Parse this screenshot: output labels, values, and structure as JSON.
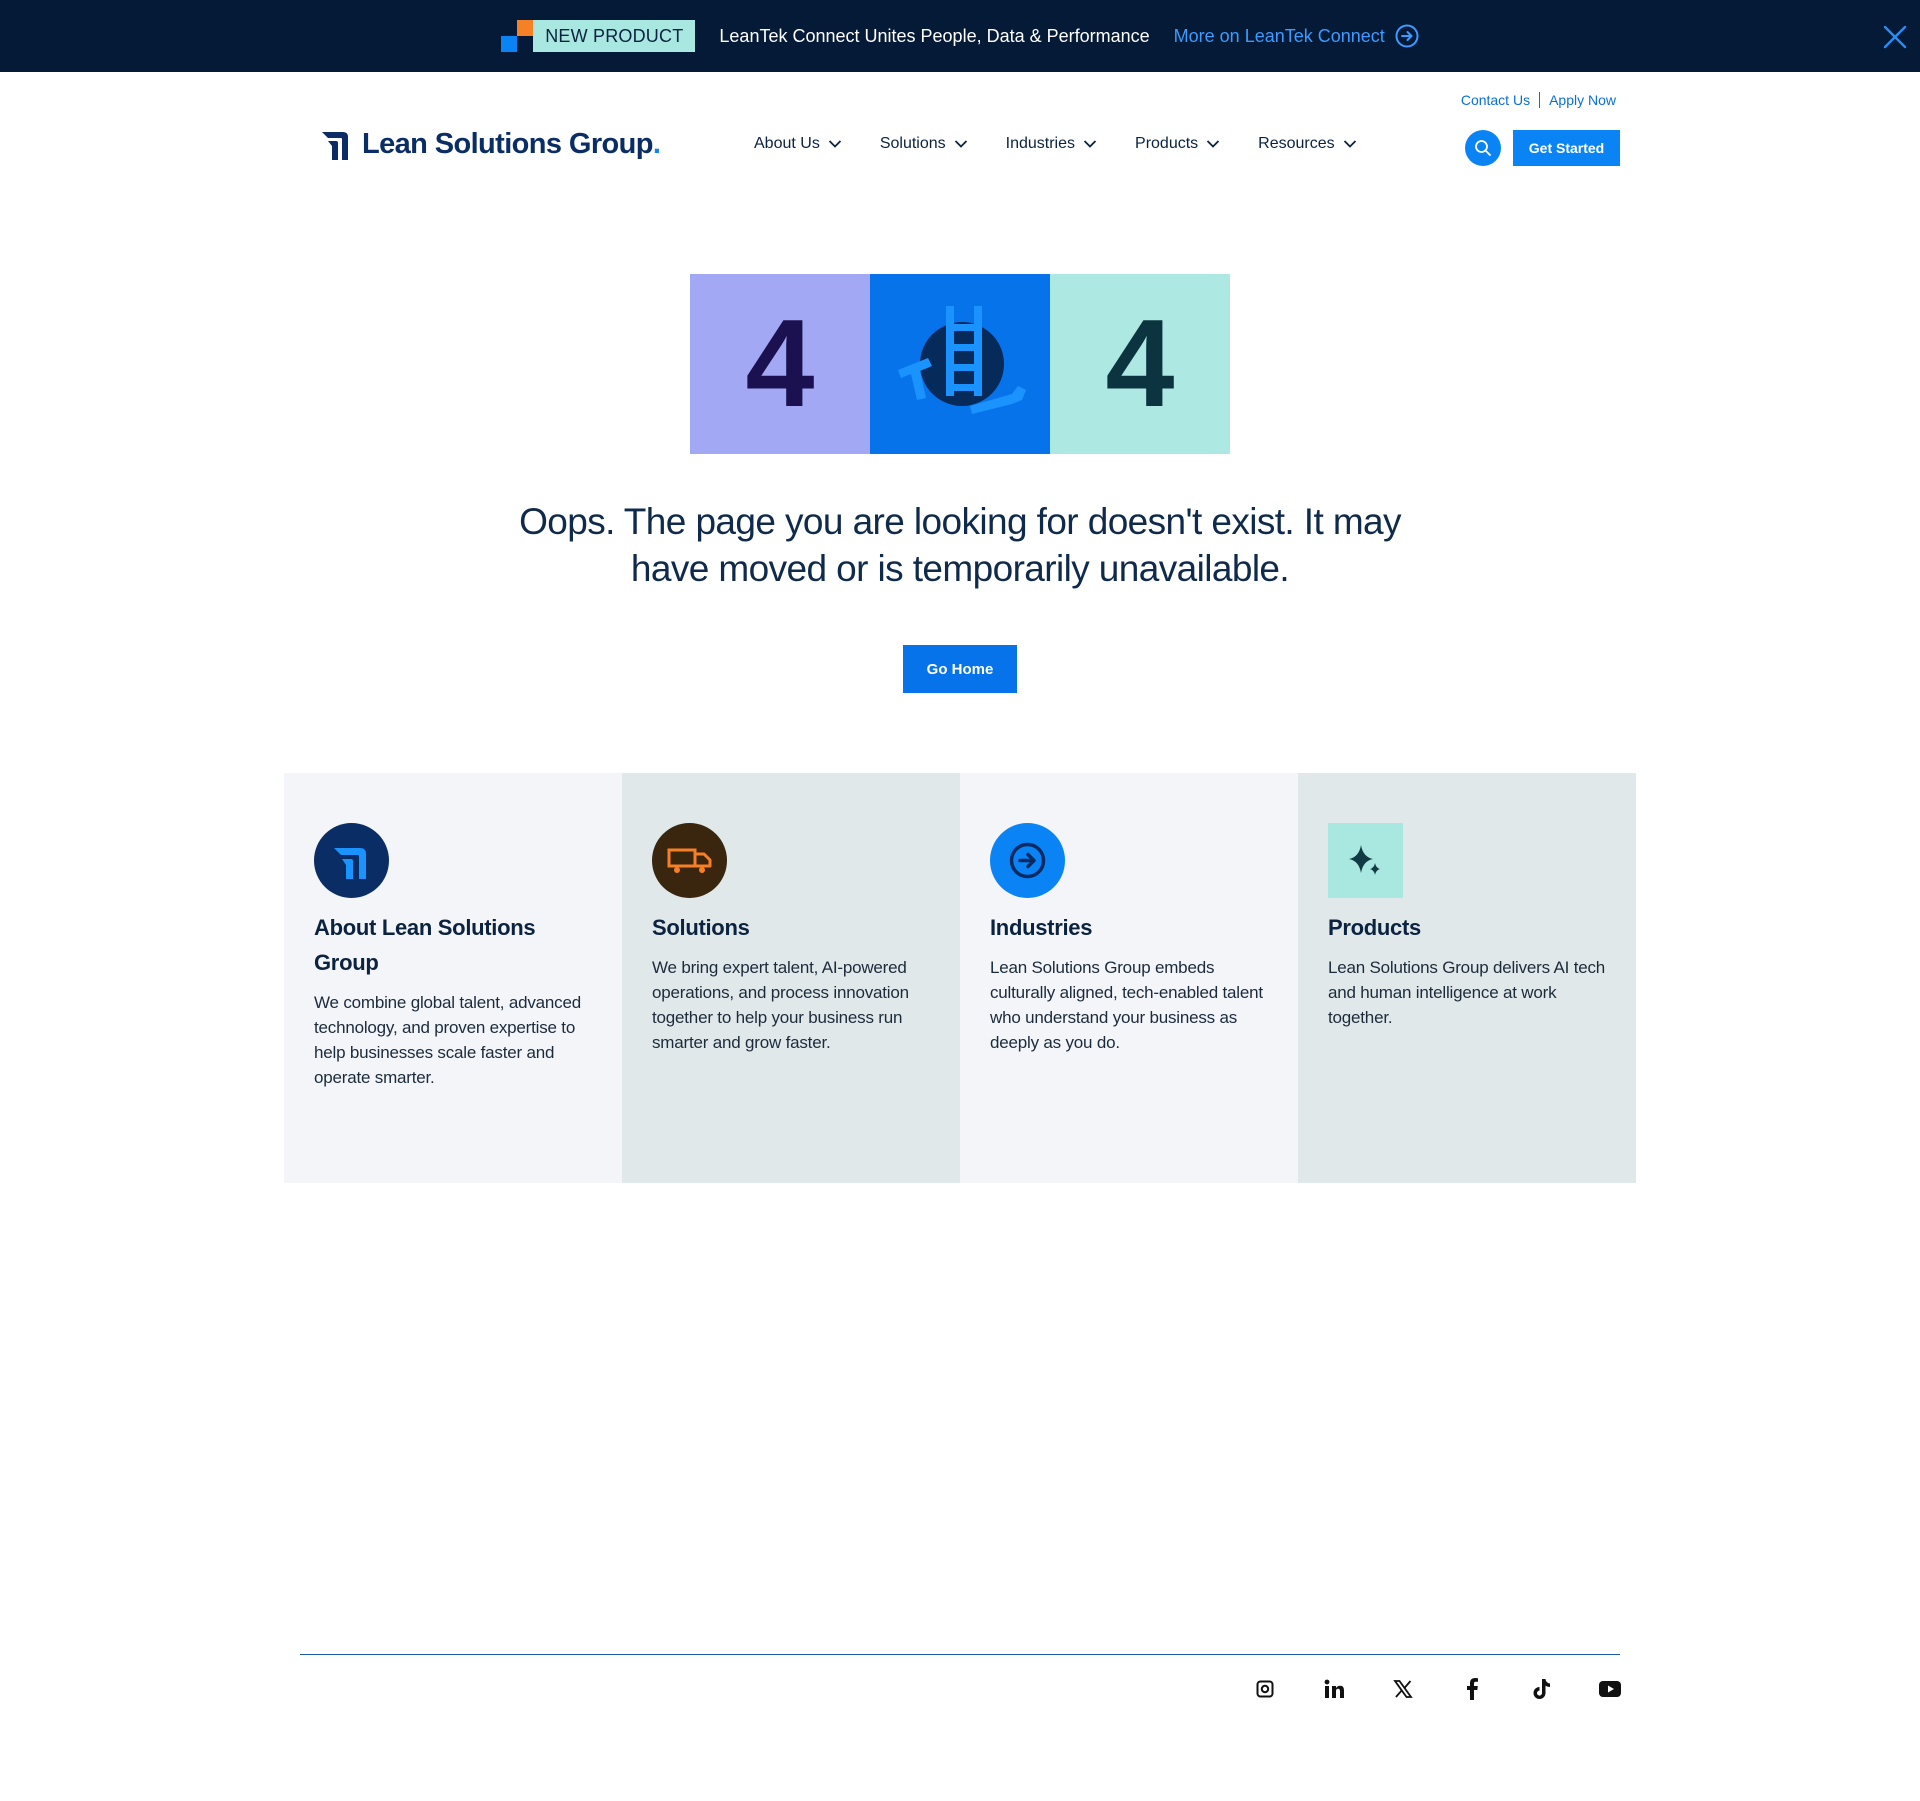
{
  "announcement": {
    "badge": "NEW PRODUCT",
    "text": "LeanTek Connect Unites People, Data & Performance",
    "link": "More on LeanTek Connect"
  },
  "header": {
    "utility": {
      "contact": "Contact Us",
      "apply": "Apply Now"
    },
    "logo": {
      "name": "Lean Solutions Group",
      "dot": "."
    },
    "nav": [
      "About Us",
      "Solutions",
      "Industries",
      "Products",
      "Resources"
    ],
    "cta": "Get Started"
  },
  "error": {
    "digit_left": "4",
    "digit_right": "4",
    "message": "Oops. The page you are looking for doesn't exist. It may have moved or is temporarily unavailable.",
    "button": "Go Home"
  },
  "cards": [
    {
      "title": "About Lean Solutions Group",
      "description": "We combine global talent, advanced technology, and proven expertise to help businesses scale faster and operate smarter.",
      "icon": "lsg-logo-icon"
    },
    {
      "title": "Solutions",
      "description": "We bring expert talent, AI-powered operations, and process innovation together to help your business run smarter and grow faster.",
      "icon": "truck-icon"
    },
    {
      "title": "Industries",
      "description": "Lean Solutions Group embeds culturally aligned, tech-enabled talent who understand your business as deeply as you do.",
      "icon": "arrow-circle-icon"
    },
    {
      "title": "Products",
      "description": "Lean Solutions Group delivers AI tech and human intelligence at work together.",
      "icon": "sparkle-icon"
    }
  ],
  "footer": {
    "socials": [
      "instagram-icon",
      "linkedin-icon",
      "x-icon",
      "facebook-icon",
      "tiktok-icon",
      "youtube-icon"
    ]
  },
  "colors": {
    "navy": "#041a36",
    "brand_blue": "#0a84f5",
    "mint": "#a9e8e1",
    "lavender": "#a2a8f4",
    "orange": "#f58025"
  }
}
